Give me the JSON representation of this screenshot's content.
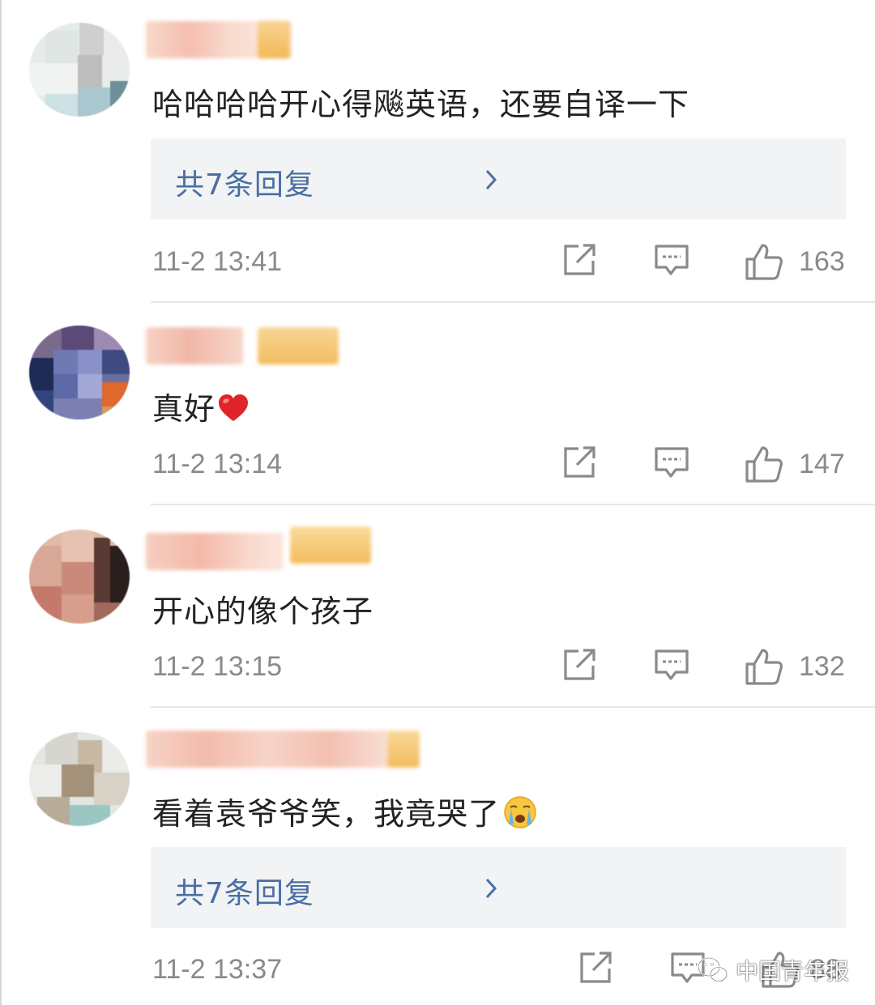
{
  "comments": [
    {
      "username": "",
      "text": "哈哈哈哈开心得飚英语，还要自译一下",
      "replies_label": "共7条回复",
      "time": "11-2 13:41",
      "likes": "163"
    },
    {
      "username": "",
      "text": "真好",
      "time": "11-2 13:14",
      "likes": "147"
    },
    {
      "username": "",
      "text": "开心的像个孩子",
      "time": "11-2 13:15",
      "likes": "132"
    },
    {
      "username": "",
      "text": "看着袁爷爷笑，我竟哭了",
      "replies_label": "共7条回复",
      "time": "11-2 13:37",
      "likes": "88"
    }
  ],
  "watermark": {
    "text": "中国青年报",
    "icon": "wechat-icon"
  },
  "icons": {
    "share": "share-icon",
    "comment": "comment-icon",
    "like": "thumbs-up-icon",
    "chevron": "chevron-right-icon"
  },
  "colors": {
    "link": "#4a6fa3",
    "meta": "#8a8a8a",
    "reply_bg": "#f2f3f5",
    "heart": "#e0242b"
  }
}
